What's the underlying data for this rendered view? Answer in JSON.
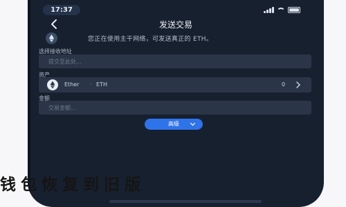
{
  "status_bar": {
    "time": "17:37"
  },
  "nav": {
    "title": "发送交易"
  },
  "notice": {
    "text": "您正在使用主干网络，可发送真正的 ETH。"
  },
  "form": {
    "address_label": "选择接收地址",
    "address_placeholder": "提交至此处...",
    "asset_label": "资产",
    "asset_name": "Ether",
    "asset_separator": "·",
    "asset_symbol": "ETH",
    "asset_balance": "0",
    "amount_label": "金额",
    "amount_placeholder": "交易金额..."
  },
  "advanced_button": {
    "label": "高级"
  },
  "overlay_caption": "钱包恢复到旧版",
  "colors": {
    "background": "#17202f",
    "field": "#2a3647",
    "accent": "#2f73ea",
    "text": "#aeb8c6"
  },
  "icons": [
    "back-arrow-icon",
    "ethereum-icon",
    "chevron-right-icon",
    "chevron-down-icon",
    "signal-icon",
    "wifi-icon",
    "battery-icon"
  ]
}
